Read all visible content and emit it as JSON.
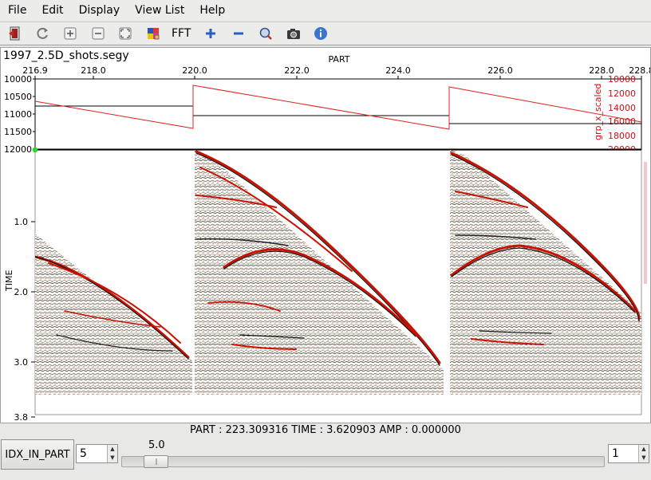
{
  "menu": {
    "items": [
      "File",
      "Edit",
      "Display",
      "View List",
      "Help"
    ]
  },
  "toolbar": {
    "fft_label": "FFT",
    "icons": [
      "exit-icon",
      "refresh-icon",
      "zoom-in-icon",
      "zoom-out-icon",
      "fit-icon",
      "palette-icon",
      "plus-icon",
      "minus-icon",
      "search-icon",
      "camera-icon",
      "info-icon"
    ]
  },
  "plot": {
    "file_title": "1997_2.5D_shots.segy",
    "x_axis_label": "PART",
    "x_ticks": [
      "216.9",
      "218.0",
      "220.0",
      "222.0",
      "224.0",
      "226.0",
      "228.0",
      "228.8"
    ],
    "header_left_ticks": [
      "10000",
      "10500",
      "11000",
      "11500",
      "12000"
    ],
    "header_right_label": "grp_x_scaled",
    "header_right_ticks": [
      "10000",
      "12000",
      "14000",
      "16000",
      "18000",
      "20000"
    ],
    "time_axis_label": "TIME",
    "time_ticks": [
      "1.0",
      "2.0",
      "3.0",
      "3.8"
    ],
    "colors": {
      "header_curve": "#e02020",
      "right_axis": "#d01010",
      "marker": "#22dd22",
      "wiggle_fill": "#cc1100"
    }
  },
  "status": {
    "text": "PART : 223.309316  TIME : 3.620903  AMP : 0.000000"
  },
  "bottom": {
    "idx_button_label": "IDX_IN_PART",
    "idx_value": "5",
    "slider_value_label": "5.0",
    "slider_fraction": 0.08,
    "step_value": "1"
  }
}
